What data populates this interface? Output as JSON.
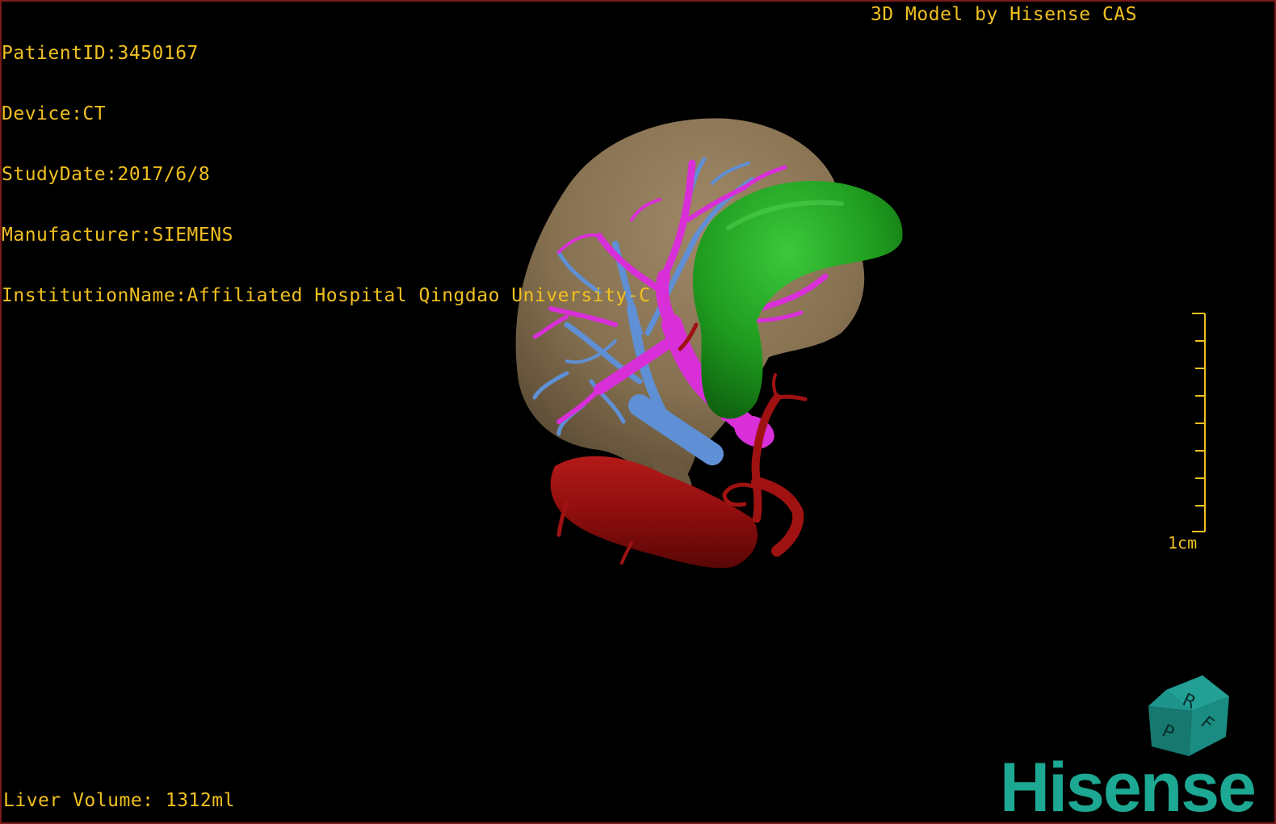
{
  "dicom_info": {
    "patient_id": "PatientID:3450167",
    "device": "Device:CT",
    "study_date": "StudyDate:2017/6/8",
    "manufacturer": "Manufacturer:SIEMENS",
    "institution": "InstitutionName:Affiliated Hospital Qingdao University-C"
  },
  "model_credit": "3D Model by Hisense CAS",
  "liver_volume": "Liver Volume: 1312ml",
  "scale_bar": {
    "label": "1cm"
  },
  "orientation_cube": {
    "labels": [
      "R",
      "F",
      "P"
    ]
  },
  "brand": "Hisense",
  "colors": {
    "overlay_text": "#f0c020",
    "liver": "#8c7454",
    "gallbladder": "#1f9a1f",
    "portal_vein": "#d82fd8",
    "hepatic_vein": "#5f8fd4",
    "artery": "#a01212",
    "brand": "#1ca892",
    "cube": "#1a8a80"
  },
  "icons": {
    "orientation_cube": "orientation-cube-icon",
    "scale_bar": "scale-ruler-icon"
  }
}
